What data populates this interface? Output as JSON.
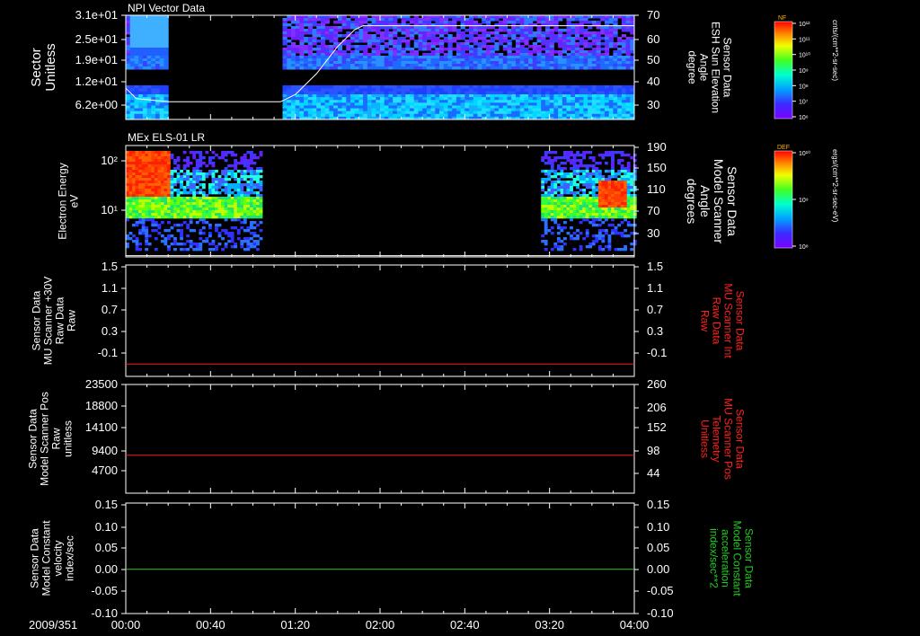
{
  "title_epoch": "2009/351",
  "time_axis": {
    "ticks": [
      "00:00",
      "00:40",
      "01:20",
      "02:00",
      "02:40",
      "03:20",
      "04:00"
    ],
    "range_minutes": [
      0,
      240
    ]
  },
  "panels": [
    {
      "id": "npi",
      "title": "NPI Vector Data",
      "left_label": [
        "Sector",
        "Unitless"
      ],
      "left_ticks": [
        "3.1e+01",
        "2.5e+01",
        "1.9e+01",
        "1.2e+01",
        "6.2e+00"
      ],
      "right_label": [
        "Sensor Data",
        "ESH Sun Elevation",
        "Angle",
        "degree"
      ],
      "right_ticks": [
        "70",
        "60",
        "50",
        "40",
        "30"
      ],
      "right_label_color": "#ffffff"
    },
    {
      "id": "els",
      "title": "MEx ELS-01 LR",
      "left_label": [
        "Electron Energy",
        "eV"
      ],
      "left_ticks": [
        "10²",
        "10¹"
      ],
      "right_label": [
        "Sensor Data",
        "Model Scanner",
        "Angle",
        "degrees"
      ],
      "right_ticks": [
        "190",
        "150",
        "110",
        "70",
        "30"
      ],
      "right_label_color": "#ffffff"
    },
    {
      "id": "mu_raw",
      "title": "",
      "left_label": [
        "Sensor Data",
        "MU Scanner +30V",
        "Raw Data",
        "Raw"
      ],
      "left_ticks": [
        "1.5",
        "1.1",
        "0.7",
        "0.3",
        "-0.1"
      ],
      "right_label": [
        "Sensor Data",
        "MU Scanner Int",
        "Raw Data",
        "Raw"
      ],
      "right_ticks": [
        "1.5",
        "1.1",
        "0.7",
        "0.3",
        "-0.1"
      ],
      "right_label_color": "#ff2020",
      "line_value": -0.1,
      "line_color": "#ff2020"
    },
    {
      "id": "pos",
      "title": "",
      "left_label": [
        "Sensor Data",
        "Model Scanner Pos",
        "Raw",
        "unitless"
      ],
      "left_ticks": [
        "23500",
        "18800",
        "14100",
        "9400",
        "4700"
      ],
      "right_label": [
        "Sensor Data",
        "MU Scanner Pos",
        "Telemetry",
        "Unitless"
      ],
      "right_ticks": [
        "260",
        "206",
        "152",
        "98",
        "44"
      ],
      "right_label_color": "#ff2020",
      "line_value": 8200,
      "line_color": "#ff2020"
    },
    {
      "id": "const",
      "title": "",
      "left_label": [
        "Sensor Data",
        "Model Constant",
        "velocity",
        "index/sec"
      ],
      "left_ticks": [
        "0.15",
        "0.10",
        "0.05",
        "0.00",
        "-0.05",
        "-0.10"
      ],
      "right_label": [
        "Sensor Data",
        "Model Constant",
        "acceleration",
        "index/sec**2"
      ],
      "right_ticks": [
        "0.15",
        "0.10",
        "0.05",
        "0.00",
        "-0.05",
        "-0.10"
      ],
      "right_label_color": "#22cc22",
      "line_value": 0.0,
      "line_color": "#22cc22"
    }
  ],
  "colorbars": [
    {
      "id": "nf",
      "tag": "NF",
      "ticks": [
        "10¹²",
        "10¹¹",
        "10¹⁰",
        "10⁹",
        "10⁸",
        "10⁷",
        "10⁶"
      ],
      "unit": "cnts/(cm**2-sr-sec)"
    },
    {
      "id": "def",
      "tag": "DEF",
      "ticks": [
        "10¹⁰",
        "10⁹",
        "10⁸"
      ],
      "unit": "ergs/(cm**2-sr-sec-eV)"
    }
  ],
  "chart_data": [
    {
      "type": "heatmap",
      "title": "NPI Vector Data",
      "xlabel": "",
      "ylabel": "Sector Unitless",
      "xlim_minutes": [
        0,
        240
      ],
      "data_gaps_minutes": [
        [
          20,
          73
        ]
      ],
      "overlay_series": [
        {
          "name": "Sensor Data ESH Sun Elevation Angle",
          "axis": "right",
          "ylim": [
            20,
            70
          ],
          "x_minutes": [
            0,
            5,
            20,
            40,
            73,
            80,
            90,
            100,
            108,
            112,
            140,
            240
          ],
          "y": [
            35,
            30,
            28.5,
            28.5,
            28.5,
            32,
            42,
            55,
            63,
            65,
            65,
            65
          ]
        }
      ]
    },
    {
      "type": "heatmap",
      "title": "MEx ELS-01 LR",
      "ylabel": "Electron Energy eV",
      "xlim_minutes": [
        0,
        240
      ],
      "data_present_minutes": [
        [
          0,
          64
        ],
        [
          196,
          240
        ]
      ],
      "overlay_series": [
        {
          "name": "Sensor Data Model Scanner Angle",
          "axis": "right",
          "ylim": [
            5,
            190
          ],
          "x_minutes": [
            0,
            240
          ],
          "y": [
            7,
            7
          ]
        }
      ]
    },
    {
      "type": "line",
      "ylabel": "Sensor Data MU Scanner +30V Raw Data Raw",
      "ylim": [
        -0.3,
        1.5
      ],
      "series": [
        {
          "x_minutes": [
            0,
            240
          ],
          "y": [
            -0.1,
            -0.1
          ]
        }
      ]
    },
    {
      "type": "line",
      "ylabel": "Sensor Data Model Scanner Pos Raw unitless",
      "ylim": [
        0,
        23500
      ],
      "series": [
        {
          "x_minutes": [
            0,
            240
          ],
          "y": [
            8200,
            8200
          ]
        }
      ]
    },
    {
      "type": "line",
      "ylabel": "Sensor Data Model Constant velocity index/sec",
      "ylim": [
        -0.1,
        0.15
      ],
      "series": [
        {
          "x_minutes": [
            0,
            240
          ],
          "y": [
            0.0,
            0.0
          ]
        }
      ]
    }
  ]
}
